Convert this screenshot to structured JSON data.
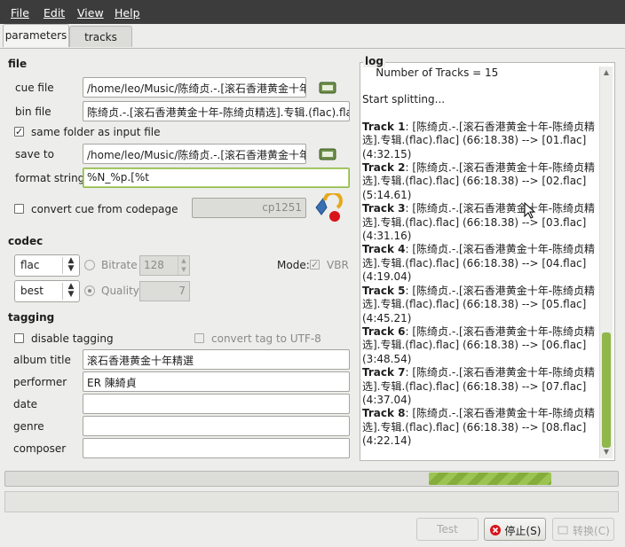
{
  "menu": [
    "File",
    "Edit",
    "View",
    "Help"
  ],
  "tabs": [
    "parameters",
    "tracks"
  ],
  "file": {
    "title": "file",
    "cue_label": "cue file",
    "cue_value": "/home/leo/Music/陈绮贞.-.[滚石香港黄金十年-陈",
    "bin_label": "bin file",
    "bin_value": "陈绮贞.-.[滚石香港黄金十年-陈绮贞精选].专辑.(flac).flac",
    "same_folder_label": "same folder as input file",
    "save_label": "save to",
    "save_value": "/home/leo/Music/陈绮贞.-.[滚石香港黄金十年-陈",
    "format_label": "format string",
    "format_value": "%N_%p.[%t",
    "codepage_label": "convert cue from codepage",
    "codepage_value": "cp1251"
  },
  "codec": {
    "title": "codec",
    "format": "flac",
    "mode": "best",
    "bitrate_label": "Bitrate",
    "bitrate_value": "128",
    "quality_label": "Quality",
    "quality_value": "7",
    "mode_label": "Mode:",
    "vbr_label": "VBR"
  },
  "tagging": {
    "title": "tagging",
    "disable_label": "disable tagging",
    "utf8_label": "convert tag to UTF-8",
    "album_label": "album title",
    "album_value": "滚石香港黄金十年精選",
    "performer_label": "performer",
    "performer_value": "ER 陳綺貞",
    "date_label": "date",
    "genre_label": "genre",
    "composer_label": "composer"
  },
  "log": {
    "title": "log",
    "tracks_line": "    Number of Tracks = 15",
    "start_line": "Start splitting...",
    "entries": [
      {
        "label": "Track 1",
        "text": ": [陈绮贞.-.[滚石香港黄金十年-陈绮贞精选].专辑.(flac).flac] (66:18.38) --> [01.flac] (4:32.15)"
      },
      {
        "label": "Track 2",
        "text": ": [陈绮贞.-.[滚石香港黄金十年-陈绮贞精选].专辑.(flac).flac] (66:18.38) --> [02.flac] (5:14.61)"
      },
      {
        "label": "Track 3",
        "text": ": [陈绮贞.-.[滚石香港黄金十年-陈绮贞精选].专辑.(flac).flac] (66:18.38) --> [03.flac] (4:31.16)"
      },
      {
        "label": "Track 4",
        "text": ": [陈绮贞.-.[滚石香港黄金十年-陈绮贞精选].专辑.(flac).flac] (66:18.38) --> [04.flac] (4:19.04)"
      },
      {
        "label": "Track 5",
        "text": ": [陈绮贞.-.[滚石香港黄金十年-陈绮贞精选].专辑.(flac).flac] (66:18.38) --> [05.flac] (4:45.21)"
      },
      {
        "label": "Track 6",
        "text": ": [陈绮贞.-.[滚石香港黄金十年-陈绮贞精选].专辑.(flac).flac] (66:18.38) --> [06.flac] (3:48.54)"
      },
      {
        "label": "Track 7",
        "text": ": [陈绮贞.-.[滚石香港黄金十年-陈绮贞精选].专辑.(flac).flac] (66:18.38) --> [07.flac] (4:37.04)"
      },
      {
        "label": "Track 8",
        "text": ": [陈绮贞.-.[滚石香港黄金十年-陈绮贞精选].专辑.(flac).flac] (66:18.38) --> [08.flac] (4:22.14)"
      }
    ]
  },
  "progress": {
    "bar1_fraction": 0.2,
    "bar2_fraction": 0
  },
  "buttons": {
    "test": "Test",
    "stop": "停止(S)",
    "convert": "转换(C)"
  },
  "colors": {
    "accent": "#8fb74a",
    "menubar": "#3c3c3c"
  }
}
